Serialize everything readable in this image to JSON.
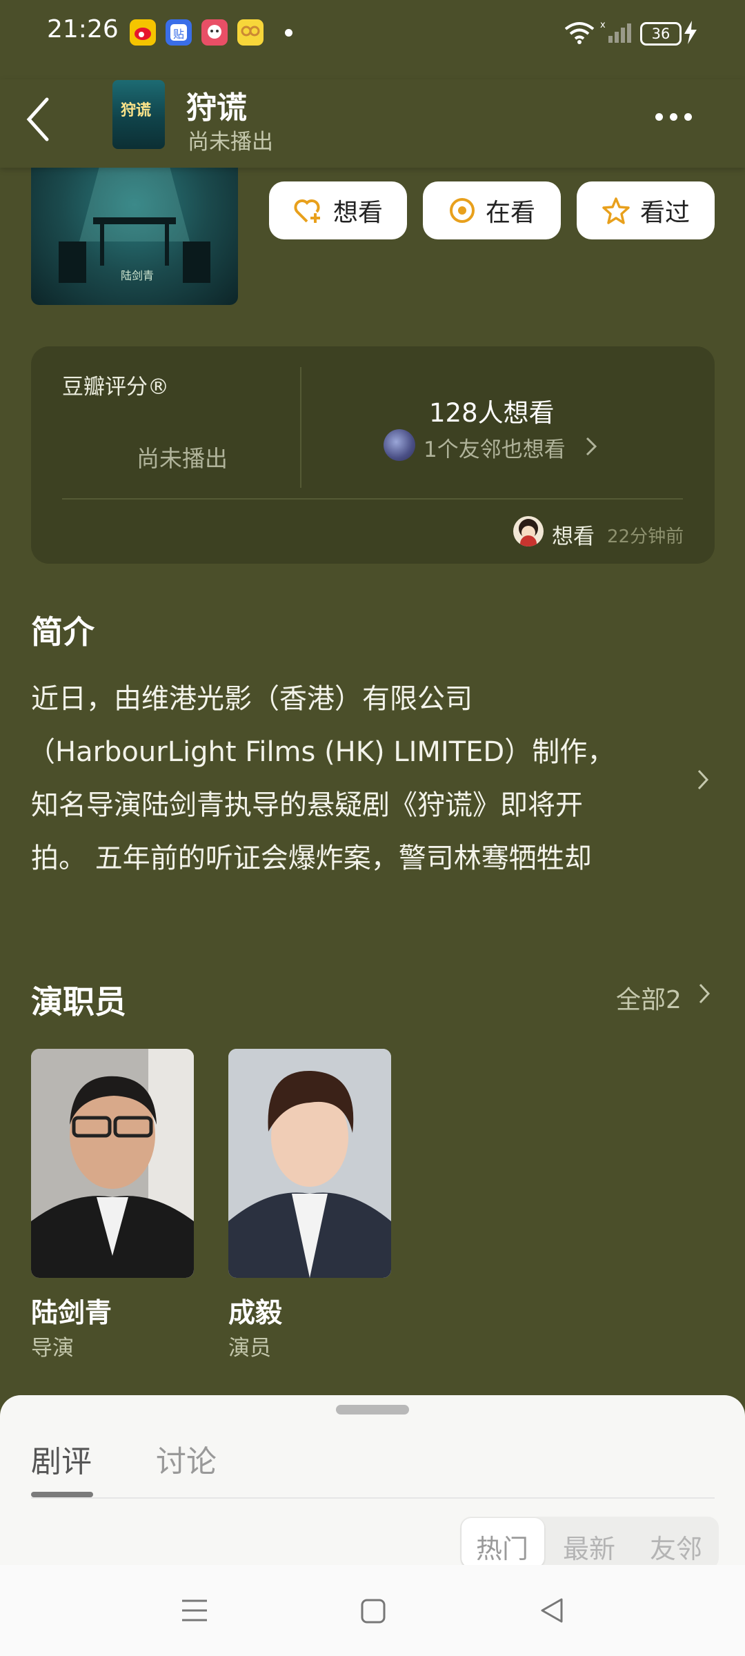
{
  "status_bar": {
    "time": "21:26",
    "apps": [
      "weibo-icon",
      "tieba-icon",
      "game-app-icon",
      "glasses-app-icon"
    ],
    "battery": "36"
  },
  "header": {
    "title": "狩谎",
    "subtitle": "尚未播出",
    "poster_text": "狩谎"
  },
  "actions": {
    "want": "想看",
    "watching": "在看",
    "watched": "看过",
    "accent": "#e8a01c"
  },
  "rating": {
    "label": "豆瓣评分®",
    "status": "尚未播出",
    "want_count": "128人想看",
    "friends_text": "1个友邻也想看",
    "recent_action": "想看",
    "recent_time": "22分钟前"
  },
  "intro": {
    "title": "简介",
    "lines": [
      "近日，由维港光影（香港）有限公司",
      "（HarbourLight Films (HK) LIMITED）制作，",
      "知名导演陆剑青执导的悬疑剧《狩谎》即将开",
      "拍。 五年前的听证会爆炸案，警司林骞牺牲却"
    ]
  },
  "cast": {
    "title": "演职员",
    "all_label": "全部2",
    "members": [
      {
        "name": "陆剑青",
        "role": "导演"
      },
      {
        "name": "成毅",
        "role": "演员"
      }
    ]
  },
  "sheet": {
    "tabs": [
      "剧评",
      "讨论"
    ],
    "filters": [
      "热门",
      "最新",
      "友邻"
    ]
  },
  "colors": {
    "background": "#4b4f2a",
    "card": "#3d4122"
  }
}
